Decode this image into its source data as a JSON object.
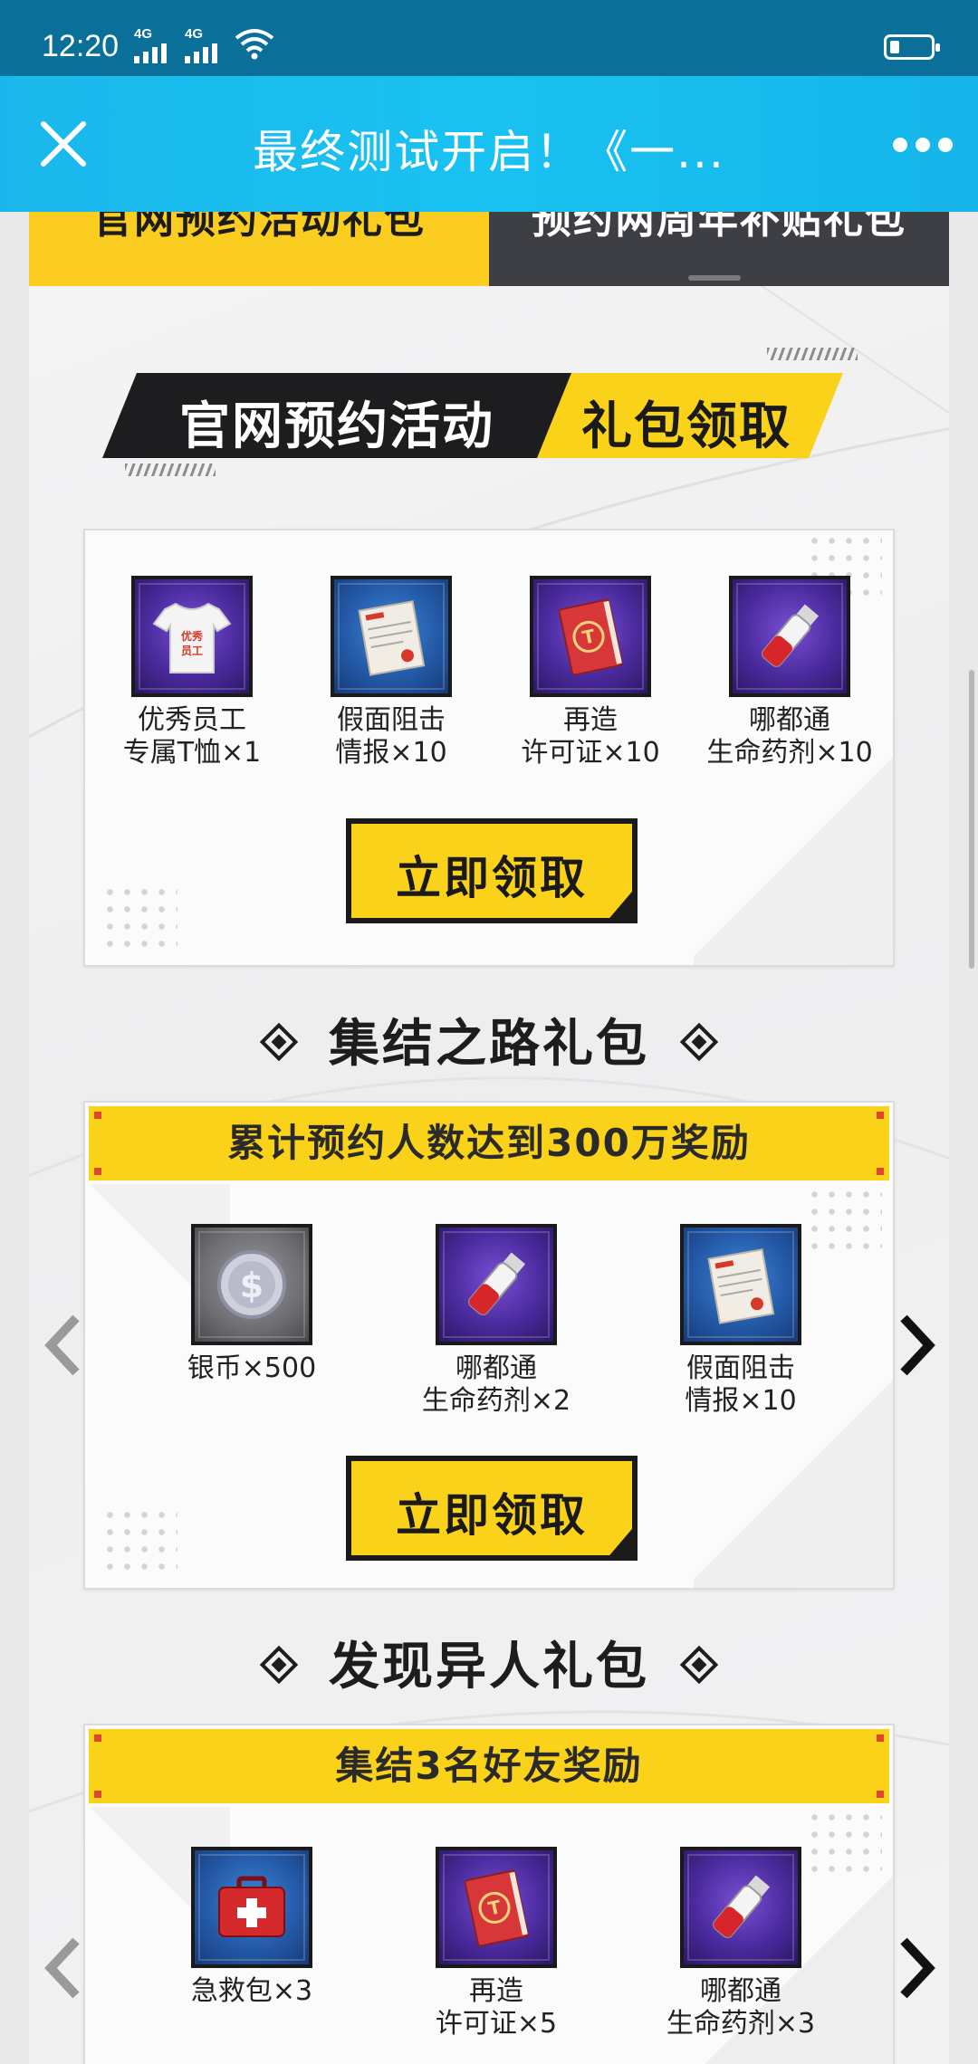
{
  "status_bar": {
    "time": "12:20",
    "network1": "4G",
    "network2": "4G"
  },
  "title_bar": {
    "title": "最终测试开启！《一..."
  },
  "tabs": [
    {
      "label": "官网预约活动礼包",
      "active": true
    },
    {
      "label": "预约两周年补贴礼包",
      "active": false
    }
  ],
  "banner": {
    "part1": "官网预约活动",
    "part2": "礼包领取"
  },
  "card1": {
    "items": [
      {
        "name": "优秀员工\n专属T恤×1",
        "icon": "tshirt-icon",
        "frame": "purple"
      },
      {
        "name": "假面阻击\n情报×10",
        "icon": "document-icon",
        "frame": "blue"
      },
      {
        "name": "再造\n许可证×10",
        "icon": "license-book-icon",
        "frame": "purple"
      },
      {
        "name": "哪都通\n生命药剂×10",
        "icon": "potion-vial-icon",
        "frame": "purple"
      }
    ],
    "claim_label": "立即领取"
  },
  "section2": {
    "title": "集结之路礼包",
    "header": "累计预约人数达到300万奖励",
    "items": [
      {
        "name": "银币×500",
        "icon": "silver-coin-icon",
        "frame": "grey"
      },
      {
        "name": "哪都通\n生命药剂×2",
        "icon": "potion-vial-icon",
        "frame": "purple"
      },
      {
        "name": "假面阻击\n情报×10",
        "icon": "document-icon",
        "frame": "blue"
      }
    ],
    "claim_label": "立即领取"
  },
  "section3": {
    "title": "发现异人礼包",
    "header": "集结3名好友奖励",
    "items": [
      {
        "name": "急救包×3",
        "icon": "first-aid-kit-icon",
        "frame": "blue"
      },
      {
        "name": "再造\n许可证×5",
        "icon": "license-book-icon",
        "frame": "purple"
      },
      {
        "name": "哪都通\n生命药剂×3",
        "icon": "potion-vial-icon",
        "frame": "purple"
      }
    ]
  },
  "colors": {
    "accent_yellow": "#fbd21a",
    "titlebar_blue": "#19c2f0",
    "statusbar": "#0a6f99",
    "dark": "#1d1d1f"
  }
}
